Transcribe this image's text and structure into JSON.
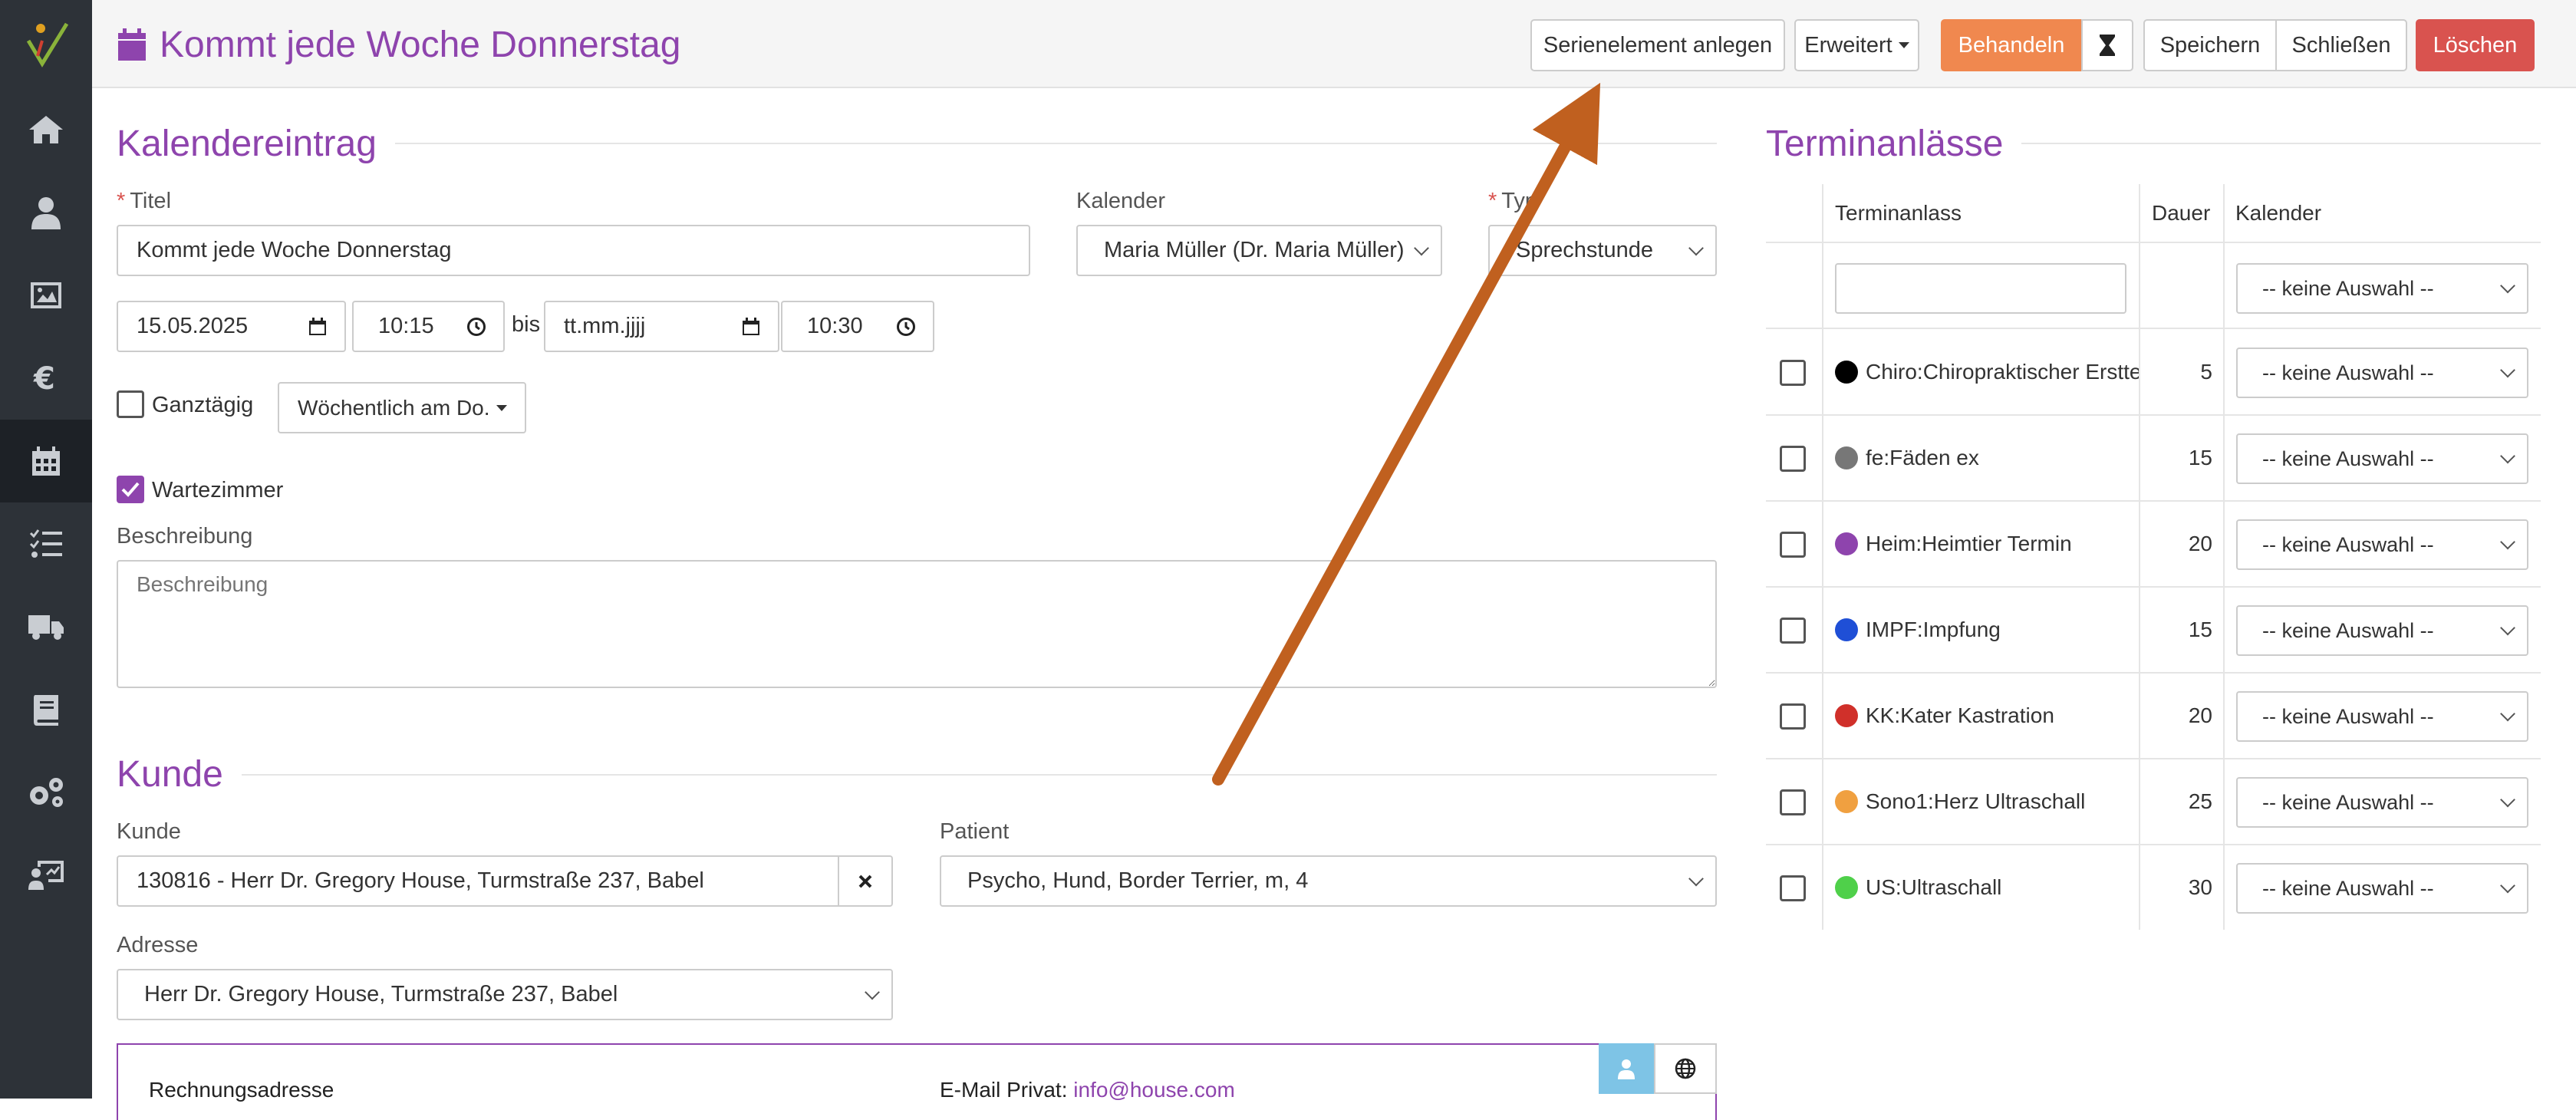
{
  "window": {
    "title": "Kommt jede Woche Donnerstag"
  },
  "toolbar": {
    "serienelement": "Serienelement anlegen",
    "erweitert": "Erweitert",
    "behandeln": "Behandeln",
    "speichern": "Speichern",
    "schliessen": "Schließen",
    "loeschen": "Löschen"
  },
  "colors": {
    "accent": "#8e44ad",
    "behandeln": "#f0884f",
    "loeschen": "#d9534f",
    "arrow": "#c0601f",
    "sidebar": "#2d3238"
  },
  "sidebar": {
    "icons": [
      "logo-icon",
      "home-icon",
      "users-icon",
      "image-icon",
      "euro-icon",
      "calendar-icon",
      "tasks-icon",
      "truck-icon",
      "book-icon",
      "gears-icon",
      "chart-user-icon"
    ],
    "active": "calendar-icon"
  },
  "kalendereintrag": {
    "section_title": "Kalendereintrag",
    "titel_label": "Titel",
    "titel_value": "Kommt jede Woche Donnerstag",
    "kalender_label": "Kalender",
    "kalender_value": "Maria Müller (Dr. Maria Müller)",
    "typ_label": "Typ",
    "typ_value": "Sprechstunde",
    "start_date": "15.05.2025",
    "start_time": "10:15",
    "bis": "bis",
    "end_date": "tt.mm.jjjj",
    "end_time": "10:30",
    "ganztaegig": "Ganztägig",
    "ganztaegig_checked": false,
    "wiederholung": "Wöchentlich am Do.",
    "wartezimmer": "Wartezimmer",
    "wartezimmer_checked": true,
    "beschreibung_label": "Beschreibung",
    "beschreibung_placeholder": "Beschreibung"
  },
  "kunde": {
    "section_title": "Kunde",
    "kunde_label": "Kunde",
    "kunde_value": "130816 - Herr Dr. Gregory House, Turmstraße 237, Babel",
    "patient_label": "Patient",
    "patient_value": "Psycho, Hund, Border Terrier, m, 4",
    "adresse_label": "Adresse",
    "adresse_value": "Herr Dr. Gregory House, Turmstraße 237, Babel",
    "rechnungsadresse": "Rechnungsadresse",
    "email_label": "E-Mail Privat:",
    "email_value": "info@house.com"
  },
  "terminanlaesse": {
    "section_title": "Terminanlässe",
    "headers": {
      "anlass": "Terminanlass",
      "dauer": "Dauer",
      "kalender": "Kalender"
    },
    "filter_placeholder": "",
    "filter_select": "-- keine Auswahl --",
    "rows": [
      {
        "label": "Chiro:Chiropraktischer Erstte",
        "color": "#000000",
        "dauer": "5",
        "kalender": "-- keine Auswahl --"
      },
      {
        "label": "fe:Fäden ex",
        "color": "#777777",
        "dauer": "15",
        "kalender": "-- keine Auswahl --"
      },
      {
        "label": "Heim:Heimtier Termin",
        "color": "#8e44ad",
        "dauer": "20",
        "kalender": "-- keine Auswahl --"
      },
      {
        "label": "IMPF:Impfung",
        "color": "#1f4fd6",
        "dauer": "15",
        "kalender": "-- keine Auswahl --"
      },
      {
        "label": "KK:Kater Kastration",
        "color": "#d0302a",
        "dauer": "20",
        "kalender": "-- keine Auswahl --"
      },
      {
        "label": "Sono1:Herz Ultraschall",
        "color": "#f0a040",
        "dauer": "25",
        "kalender": "-- keine Auswahl --"
      },
      {
        "label": "US:Ultraschall",
        "color": "#4fd04a",
        "dauer": "30",
        "kalender": "-- keine Auswahl --"
      }
    ]
  }
}
